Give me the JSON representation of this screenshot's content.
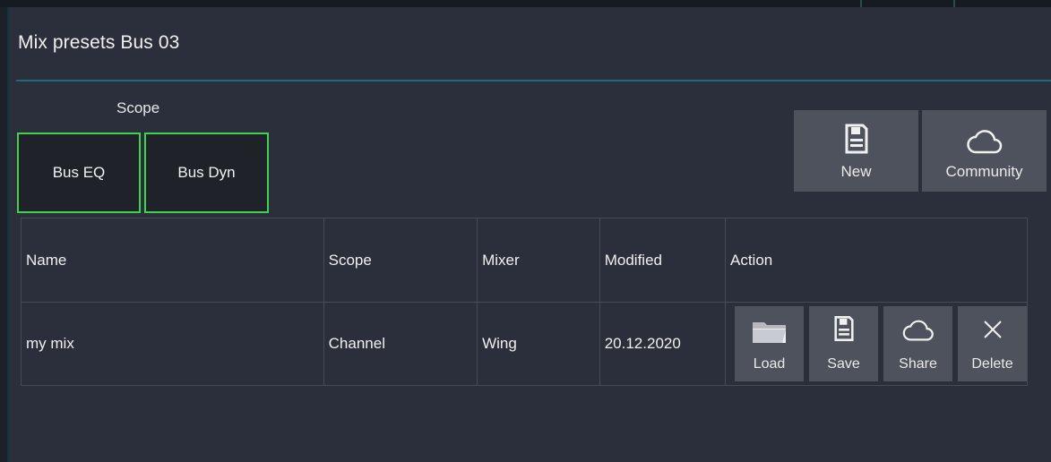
{
  "dialog": {
    "title": "Mix presets Bus 03"
  },
  "scope": {
    "label": "Scope",
    "buttons": [
      {
        "label": "Bus EQ"
      },
      {
        "label": "Bus Dyn"
      }
    ],
    "active_border_color": "#3fd24a"
  },
  "toolbar": {
    "new_label": "New",
    "new_icon": "floppy-disk-icon",
    "community_label": "Community",
    "community_icon": "cloud-icon"
  },
  "table": {
    "columns": [
      "Name",
      "Scope",
      "Mixer",
      "Modified",
      "Action"
    ],
    "rows": [
      {
        "name": "my mix",
        "scope": "Channel",
        "mixer": "Wing",
        "modified": "20.12.2020",
        "actions": [
          {
            "label": "Load",
            "icon": "folder-icon"
          },
          {
            "label": "Save",
            "icon": "floppy-disk-icon"
          },
          {
            "label": "Share",
            "icon": "cloud-icon"
          },
          {
            "label": "Delete",
            "icon": "close-icon"
          }
        ]
      }
    ]
  },
  "colors": {
    "background": "#2b2f3b",
    "button": "#4e525d",
    "accent_rule": "#1f6a76"
  }
}
